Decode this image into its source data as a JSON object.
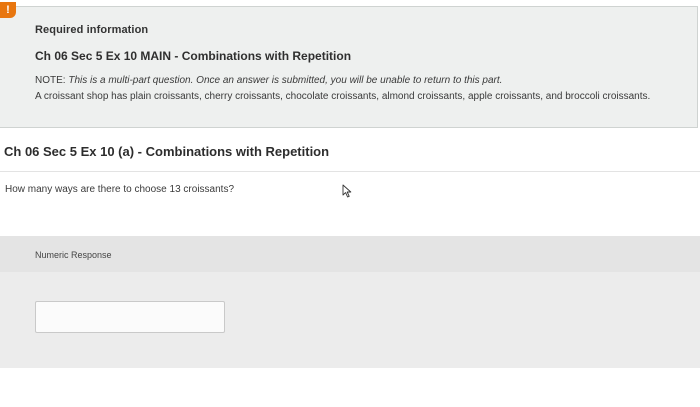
{
  "required_info": {
    "badge": "!",
    "heading": "Required information",
    "title": "Ch 06 Sec 5 Ex 10 MAIN - Combinations with Repetition",
    "note_prefix": "NOTE: ",
    "note_body": "This is a multi-part question. Once an answer is submitted, you will be unable to return to this part.",
    "description": "A croissant shop has plain croissants, cherry croissants, chocolate croissants, almond croissants, apple croissants, and broccoli croissants."
  },
  "part": {
    "title": "Ch 06 Sec 5 Ex 10 (a) - Combinations with Repetition",
    "question": "How many ways are there to choose 13 croissants?"
  },
  "response": {
    "label": "Numeric Response",
    "value": ""
  },
  "colors": {
    "alert": "#e8760f",
    "info_bg": "#eef0ef",
    "response_bg": "#ececec"
  },
  "icons": {
    "alert": "alert-badge-icon",
    "cursor": "mouse-pointer-icon"
  }
}
